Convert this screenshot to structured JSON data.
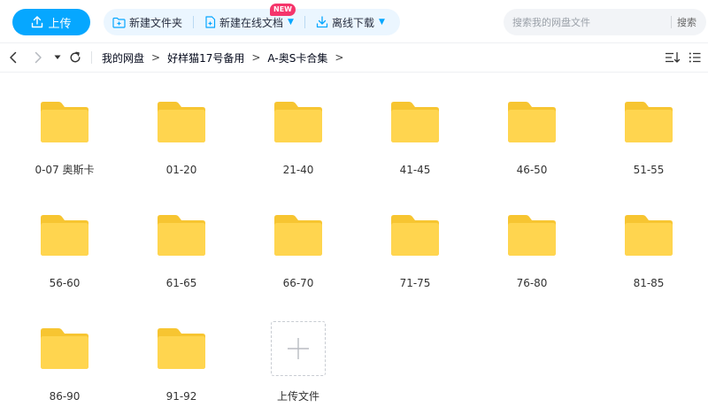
{
  "toolbar": {
    "upload_label": "上传",
    "new_folder_label": "新建文件夹",
    "new_online_doc_label": "新建在线文档",
    "new_badge": "NEW",
    "offline_download_label": "离线下载",
    "search_placeholder": "搜索我的网盘文件",
    "search_button": "搜索"
  },
  "breadcrumb": [
    "我的网盘",
    "好样猫17号备用",
    "A-奥S卡合集"
  ],
  "breadcrumb_separator": ">",
  "items": [
    {
      "label": "0-07 奥斯卡"
    },
    {
      "label": "01-20"
    },
    {
      "label": "21-40"
    },
    {
      "label": "41-45"
    },
    {
      "label": "46-50"
    },
    {
      "label": "51-55"
    },
    {
      "label": "56-60"
    },
    {
      "label": "61-65"
    },
    {
      "label": "66-70"
    },
    {
      "label": "71-75"
    },
    {
      "label": "76-80"
    },
    {
      "label": "81-85"
    },
    {
      "label": "86-90"
    },
    {
      "label": "91-92"
    }
  ],
  "upload_tile_label": "上传文件",
  "colors": {
    "accent": "#06a7ff",
    "folder_body": "#ffd54f",
    "folder_tab": "#f7c531",
    "badge": "#f5356b"
  },
  "icons": {
    "upload": "upload-icon",
    "new_folder": "new-folder-icon",
    "new_doc": "new-doc-icon",
    "download": "download-icon",
    "back": "chevron-left-icon",
    "forward": "chevron-right-icon",
    "history": "caret-down-icon",
    "refresh": "refresh-icon",
    "sort": "sort-icon",
    "list_view": "list-view-icon",
    "folder": "folder-icon",
    "plus": "plus-icon"
  }
}
